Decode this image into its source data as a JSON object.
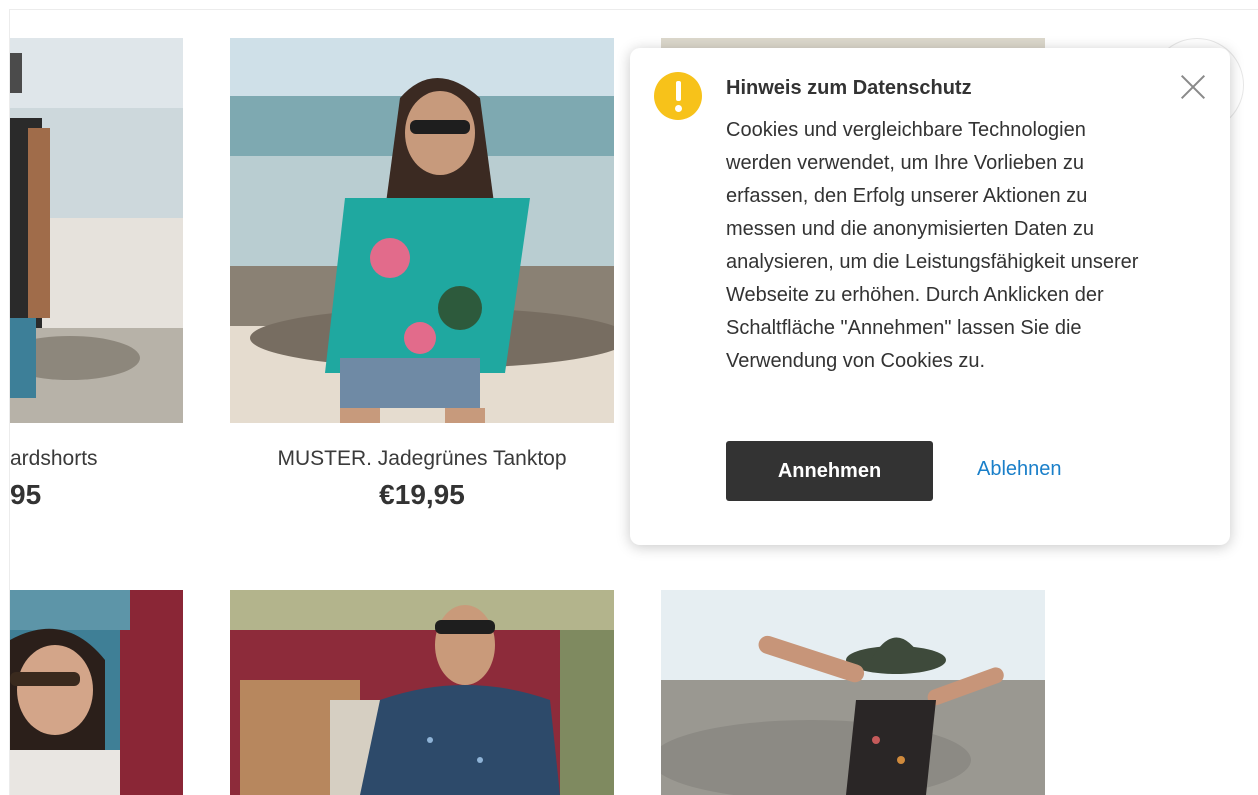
{
  "products": [
    {
      "name": "ardshorts",
      "price": "95"
    },
    {
      "name": "MUSTER. Jadegrünes Tanktop",
      "price": "€19,95"
    }
  ],
  "images": [
    {
      "name": "beach-man-photo"
    },
    {
      "name": "woman-tanktop-photo"
    },
    {
      "name": "top-right-photo"
    },
    {
      "name": "woman-van-photo"
    },
    {
      "name": "man-van-photo"
    },
    {
      "name": "woman-hat-photo"
    }
  ],
  "popup": {
    "title": "Hinweis zum Datenschutz",
    "text": "Cookies und vergleichbare Technologien werden verwendet, um Ihre Vorlieben zu erfassen, den Erfolg unserer Aktionen zu messen und die anonymisierten Daten zu analysieren, um die Leistungsfähigkeit unserer Webseite zu erhöhen. Durch Anklicken der Schaltfläche \"Annehmen\" lassen Sie die Verwendung von Cookies zu.",
    "accept_label": "Annehmen",
    "decline_label": "Ablehnen",
    "icon": "exclamation-icon",
    "close_icon": "close-icon"
  },
  "colors": {
    "warning": "#f7c21a",
    "accept_bg": "#333333",
    "link": "#1a7fc9"
  }
}
